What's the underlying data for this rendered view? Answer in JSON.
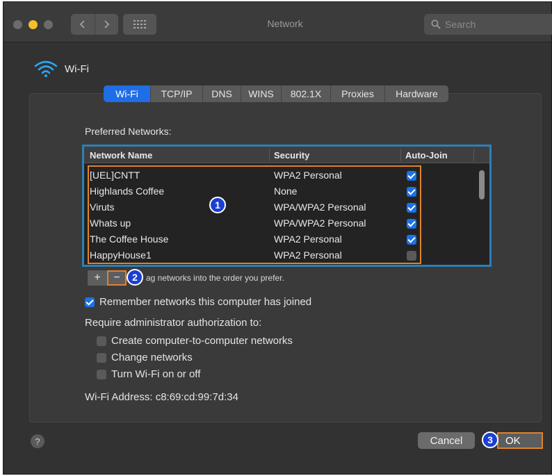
{
  "window": {
    "title": "Network"
  },
  "toolbar": {
    "search_placeholder": "Search"
  },
  "header": {
    "title": "Wi-Fi"
  },
  "tabs": [
    {
      "label": "Wi-Fi",
      "active": true
    },
    {
      "label": "TCP/IP",
      "active": false
    },
    {
      "label": "DNS",
      "active": false
    },
    {
      "label": "WINS",
      "active": false
    },
    {
      "label": "802.1X",
      "active": false
    },
    {
      "label": "Proxies",
      "active": false
    },
    {
      "label": "Hardware",
      "active": false
    }
  ],
  "preferred": {
    "label": "Preferred Networks:",
    "columns": {
      "name": "Network Name",
      "security": "Security",
      "autojoin": "Auto-Join"
    },
    "networks": [
      {
        "name": "[UEL]CNTT",
        "security": "WPA2 Personal",
        "auto_join": true
      },
      {
        "name": "Highlands Coffee",
        "security": "None",
        "auto_join": true
      },
      {
        "name": "Viruts",
        "security": "WPA/WPA2 Personal",
        "auto_join": true
      },
      {
        "name": "Whats up",
        "security": "WPA/WPA2 Personal",
        "auto_join": true
      },
      {
        "name": "The Coffee House",
        "security": "WPA2 Personal",
        "auto_join": true
      },
      {
        "name": "HappyHouse1",
        "security": "WPA2 Personal",
        "auto_join": false
      }
    ],
    "add_label": "+",
    "remove_label": "−",
    "drag_hint": "ag networks into the order you prefer."
  },
  "options": {
    "remember": {
      "label": "Remember networks this computer has joined",
      "checked": true
    },
    "require_label": "Require administrator authorization to:",
    "create": {
      "label": "Create computer-to-computer networks",
      "checked": false
    },
    "change": {
      "label": "Change networks",
      "checked": false
    },
    "toggle": {
      "label": "Turn Wi-Fi on or off",
      "checked": false
    }
  },
  "address": {
    "label": "Wi-Fi Address:",
    "value": "c8:69:cd:99:7d:34"
  },
  "footer": {
    "help": "?",
    "cancel": "Cancel",
    "ok": "OK"
  },
  "markers": {
    "one": "1",
    "two": "2",
    "three": "3"
  },
  "icons": {
    "traffic_lights": [
      "#6b6b6b",
      "#f5bf2e",
      "#6b6b6b"
    ],
    "back": "chevron-left-icon",
    "forward": "chevron-right-icon",
    "grid": "grid-icon",
    "search": "search-icon",
    "wifi": "wifi-icon"
  },
  "colors": {
    "accent": "#1f6ee5",
    "highlight": "#e0832b",
    "marker": "#1a3fd1",
    "table_focus": "#2d7fb8"
  }
}
